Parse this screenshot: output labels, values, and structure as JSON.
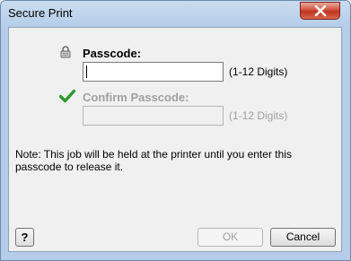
{
  "window": {
    "title": "Secure Print"
  },
  "passcode": {
    "label": "Passcode:",
    "value": "",
    "hint": "(1-12 Digits)"
  },
  "confirm": {
    "label": "Confirm Passcode:",
    "value": "",
    "hint": "(1-12 Digits)",
    "enabled": false
  },
  "note": "Note:  This job will be held at the printer until you enter this passcode to release it.",
  "buttons": {
    "help": "?",
    "ok": "OK",
    "cancel": "Cancel"
  },
  "icons": {
    "close": "close-icon",
    "lock": "lock-icon",
    "check": "checkmark-icon"
  },
  "colors": {
    "check_green": "#2e9a2e",
    "disabled_text": "#a0a0a0",
    "close_red": "#c03320"
  }
}
